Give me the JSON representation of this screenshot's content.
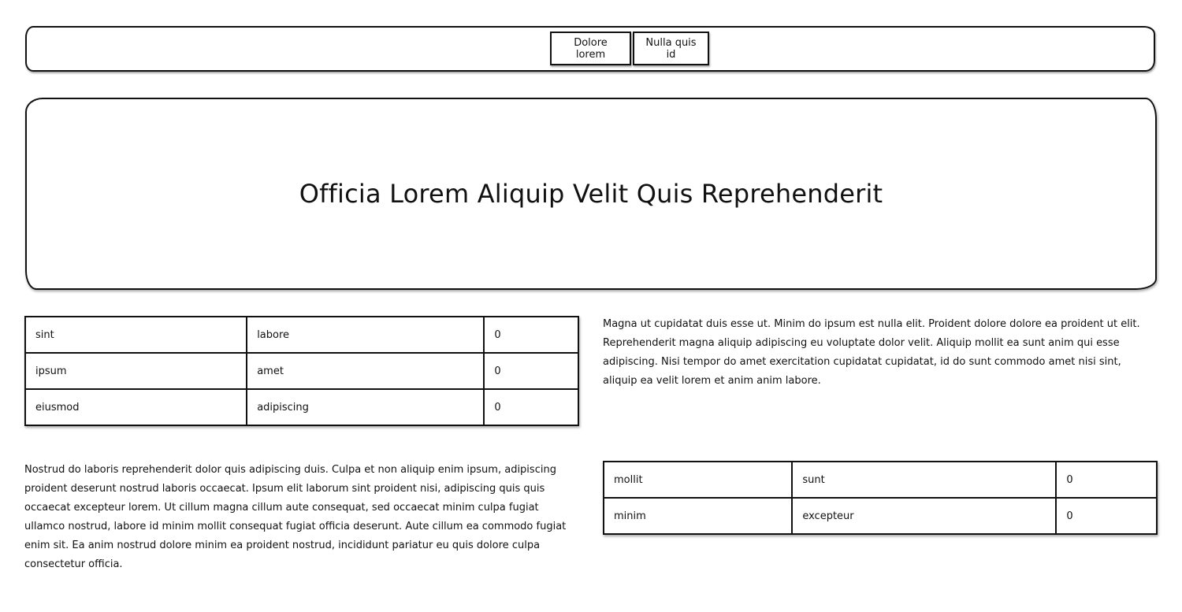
{
  "nav": {
    "buttons": [
      {
        "label": "Dolore lorem"
      },
      {
        "label": "Nulla quis id"
      }
    ]
  },
  "hero": {
    "title": "Officia Lorem Aliquip Velit Quis Reprehenderit"
  },
  "table_a": {
    "rows": [
      [
        "sint",
        "labore",
        "0"
      ],
      [
        "ipsum",
        "amet",
        "0"
      ],
      [
        "eiusmod",
        "adipiscing",
        "0"
      ]
    ]
  },
  "paragraph_right": "Magna ut cupidatat duis esse ut. Minim do ipsum est nulla elit. Proident dolore dolore ea proident ut elit. Reprehenderit magna aliquip adipiscing eu voluptate dolor velit. Aliquip mollit ea sunt anim qui esse adipiscing. Nisi tempor do amet exercitation cupidatat cupidatat, id do sunt commodo amet nisi sint, aliquip ea velit lorem et anim anim labore.",
  "paragraph_left": "Nostrud do laboris reprehenderit dolor quis adipiscing duis. Culpa et non aliquip enim ipsum, adipiscing proident deserunt nostrud laboris occaecat. Ipsum elit laborum sint proident nisi, adipiscing quis quis occaecat excepteur lorem. Ut cillum magna cillum aute consequat, sed occaecat minim culpa fugiat ullamco nostrud, labore id minim mollit consequat fugiat officia deserunt. Aute cillum ea commodo fugiat enim sit. Ea anim nostrud dolore minim ea proident nostrud, incididunt pariatur eu quis dolore culpa consectetur officia.",
  "table_b": {
    "rows": [
      [
        "mollit",
        "sunt",
        "0"
      ],
      [
        "minim",
        "excepteur",
        "0"
      ]
    ]
  }
}
